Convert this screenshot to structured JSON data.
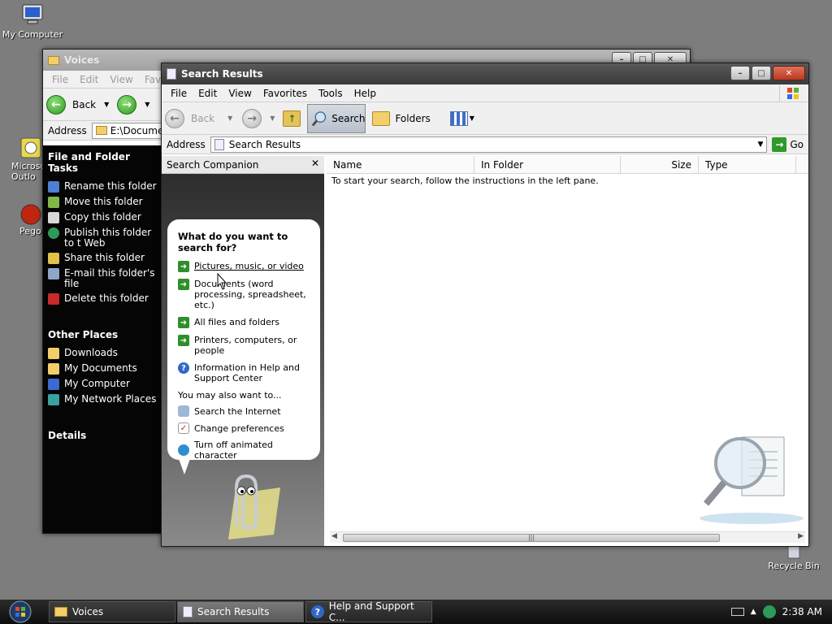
{
  "desktop": {
    "icons": [
      {
        "label": "My Computer"
      },
      {
        "label": "Microso\nOutlo"
      },
      {
        "label": "Pego"
      },
      {
        "label": "Recycle Bin"
      }
    ]
  },
  "voices_window": {
    "title": "Voices",
    "menu": [
      "File",
      "Edit",
      "View",
      "Favo"
    ],
    "back_label": "Back",
    "address_label": "Address",
    "address_value": "E:\\Documents",
    "tasks_heading": "File and Folder Tasks",
    "tasks": [
      "Rename this folder",
      "Move this folder",
      "Copy this folder",
      "Publish this folder to t Web",
      "Share this folder",
      "E-mail this folder's file",
      "Delete this folder"
    ],
    "other_heading": "Other Places",
    "other_places": [
      "Downloads",
      "My Documents",
      "My Computer",
      "My Network Places"
    ],
    "details_heading": "Details"
  },
  "search_window": {
    "title": "Search Results",
    "menu": [
      "File",
      "Edit",
      "View",
      "Favorites",
      "Tools",
      "Help"
    ],
    "toolbar": {
      "back": "Back",
      "search": "Search",
      "folders": "Folders"
    },
    "address_label": "Address",
    "address_value": "Search Results",
    "go_label": "Go",
    "companion_title": "Search Companion",
    "question": "What do you want to search for?",
    "options": [
      "Pictures, music, or video",
      "Documents (word processing, spreadsheet, etc.)",
      "All files and folders",
      "Printers, computers, or people",
      "Information in Help and Support Center"
    ],
    "also_label": "You may also want to...",
    "also_options": [
      "Search the Internet",
      "Change preferences",
      "Turn off animated character"
    ],
    "columns": [
      "Name",
      "In Folder",
      "Size",
      "Type"
    ],
    "empty_message": "To start your search, follow the instructions in the left pane."
  },
  "taskbar": {
    "tasks": [
      "Voices",
      "Search Results",
      "Help and Support C..."
    ],
    "clock": "2:38 AM"
  },
  "colors": {
    "accent_green": "#2f8f2a",
    "title_dark": "#3a3a3a"
  }
}
